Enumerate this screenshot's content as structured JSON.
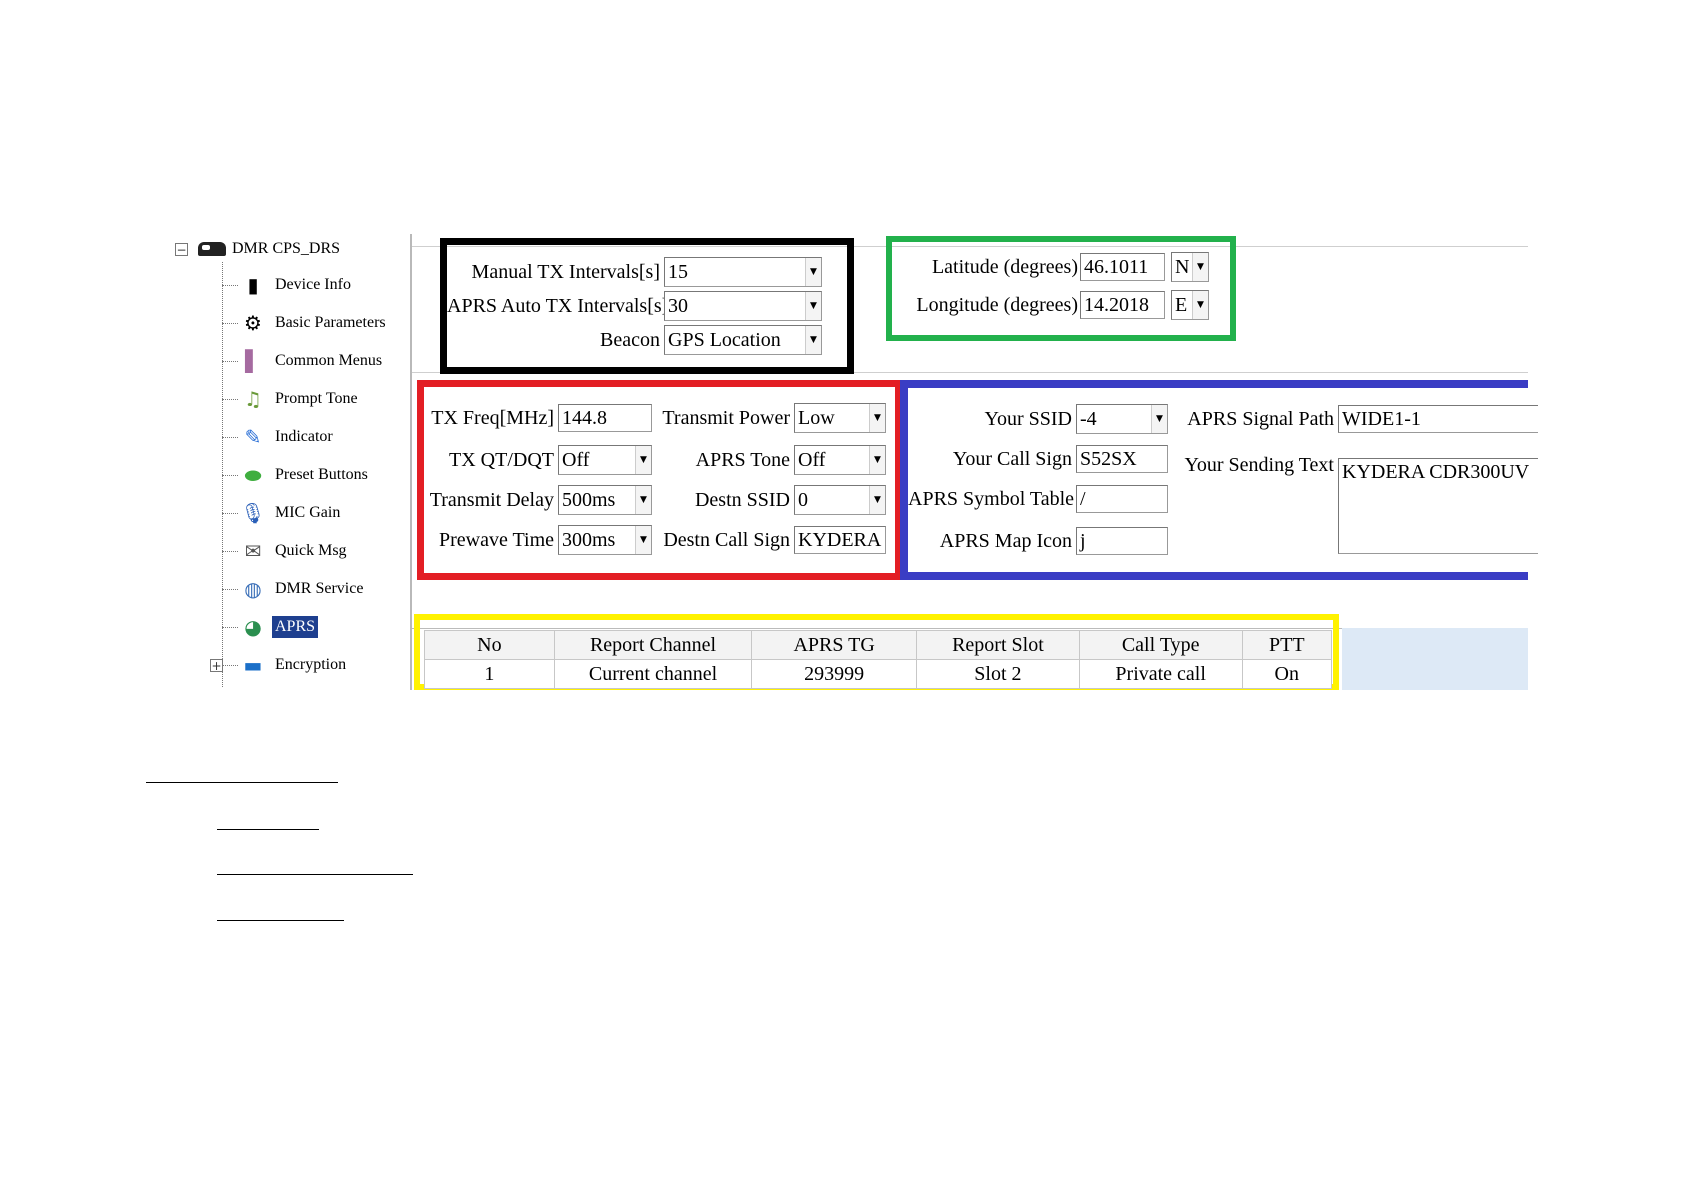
{
  "tree": {
    "root": "DMR CPS_DRS",
    "items": [
      {
        "label": "Device Info",
        "icon": "device-icon"
      },
      {
        "label": "Basic Parameters",
        "icon": "gear-icon"
      },
      {
        "label": "Common Menus",
        "icon": "menu-icon"
      },
      {
        "label": "Prompt Tone",
        "icon": "music-icon"
      },
      {
        "label": "Indicator",
        "icon": "indicator-icon"
      },
      {
        "label": "Preset Buttons",
        "icon": "button-icon"
      },
      {
        "label": "MIC Gain",
        "icon": "microphone-icon"
      },
      {
        "label": "Quick Msg",
        "icon": "message-icon"
      },
      {
        "label": "DMR Service",
        "icon": "globe-icon"
      },
      {
        "label": "APRS",
        "icon": "aprs-icon",
        "selected": true
      },
      {
        "label": "Encryption",
        "icon": "folder-icon"
      }
    ]
  },
  "tx_settings": {
    "manual_label": "Manual TX Intervals[s]",
    "manual_value": "15",
    "auto_label": "APRS Auto TX Intervals[s]",
    "auto_value": "30",
    "beacon_label": "Beacon",
    "beacon_value": "GPS Location"
  },
  "location": {
    "lat_label": "Latitude (degrees)",
    "lat_value": "46.1011",
    "lat_dir": "N",
    "lon_label": "Longitude (degrees)",
    "lon_value": "14.2018",
    "lon_dir": "E"
  },
  "radio": {
    "tx_freq_label": "TX Freq[MHz]",
    "tx_freq_value": "144.8",
    "tx_qt_label": "TX QT/DQT",
    "tx_qt_value": "Off",
    "tx_delay_label": "Transmit Delay",
    "tx_delay_value": "500ms",
    "prewave_label": "Prewave Time",
    "prewave_value": "300ms",
    "power_label": "Transmit Power",
    "power_value": "Low",
    "aprs_tone_label": "APRS Tone",
    "aprs_tone_value": "Off",
    "destn_ssid_label": "Destn SSID",
    "destn_ssid_value": "0",
    "destn_call_label": "Destn Call Sign",
    "destn_call_value": "KYDERA"
  },
  "station": {
    "ssid_label": "Your SSID",
    "ssid_value": "-4",
    "call_label": "Your Call Sign",
    "call_value": "S52SX",
    "symtable_label": "APRS Symbol Table",
    "symtable_value": "/",
    "mapicon_label": "APRS Map Icon",
    "mapicon_value": "j",
    "path_label": "APRS Signal Path",
    "path_value": "WIDE1-1",
    "text_label": "Your Sending Text",
    "text_value": "KYDERA CDR300UV"
  },
  "report_table": {
    "headers": [
      "No",
      "Report Channel",
      "APRS TG",
      "Report Slot",
      "Call Type",
      "PTT"
    ],
    "rows": [
      [
        "1",
        "Current channel",
        "293999",
        "Slot 2",
        "Private call",
        "On"
      ]
    ]
  },
  "colors": {
    "black_box": "#000000",
    "green_box": "#22b14c",
    "red_box": "#e31e24",
    "blue_box": "#3a3dc4",
    "yellow_box": "#fff200",
    "selection": "#1e3f8f"
  }
}
